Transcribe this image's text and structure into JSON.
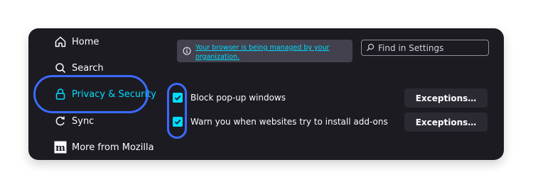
{
  "sidebar": {
    "items": [
      {
        "label": "Home",
        "icon": "home-icon"
      },
      {
        "label": "Search",
        "icon": "search-icon"
      },
      {
        "label": "Privacy & Security",
        "icon": "lock-icon",
        "selected": true
      },
      {
        "label": "Sync",
        "icon": "sync-icon"
      },
      {
        "label": "More from Mozilla",
        "icon": "mozilla-icon"
      }
    ]
  },
  "banner": {
    "icon": "info-icon",
    "text": "Your browser is being managed by your organization."
  },
  "search": {
    "placeholder": "Find in Settings"
  },
  "permissions": [
    {
      "label": "Block pop-up windows",
      "checked": true,
      "button": "Exceptions…"
    },
    {
      "label": "Warn you when websites try to install add-ons",
      "checked": true,
      "button": "Exceptions…"
    }
  ],
  "colors": {
    "background": "#1c1b22",
    "accent": "#00ddff",
    "highlight_ring": "#3a6bff",
    "button_bg": "#2b2a33",
    "banner_bg": "#42414d"
  }
}
